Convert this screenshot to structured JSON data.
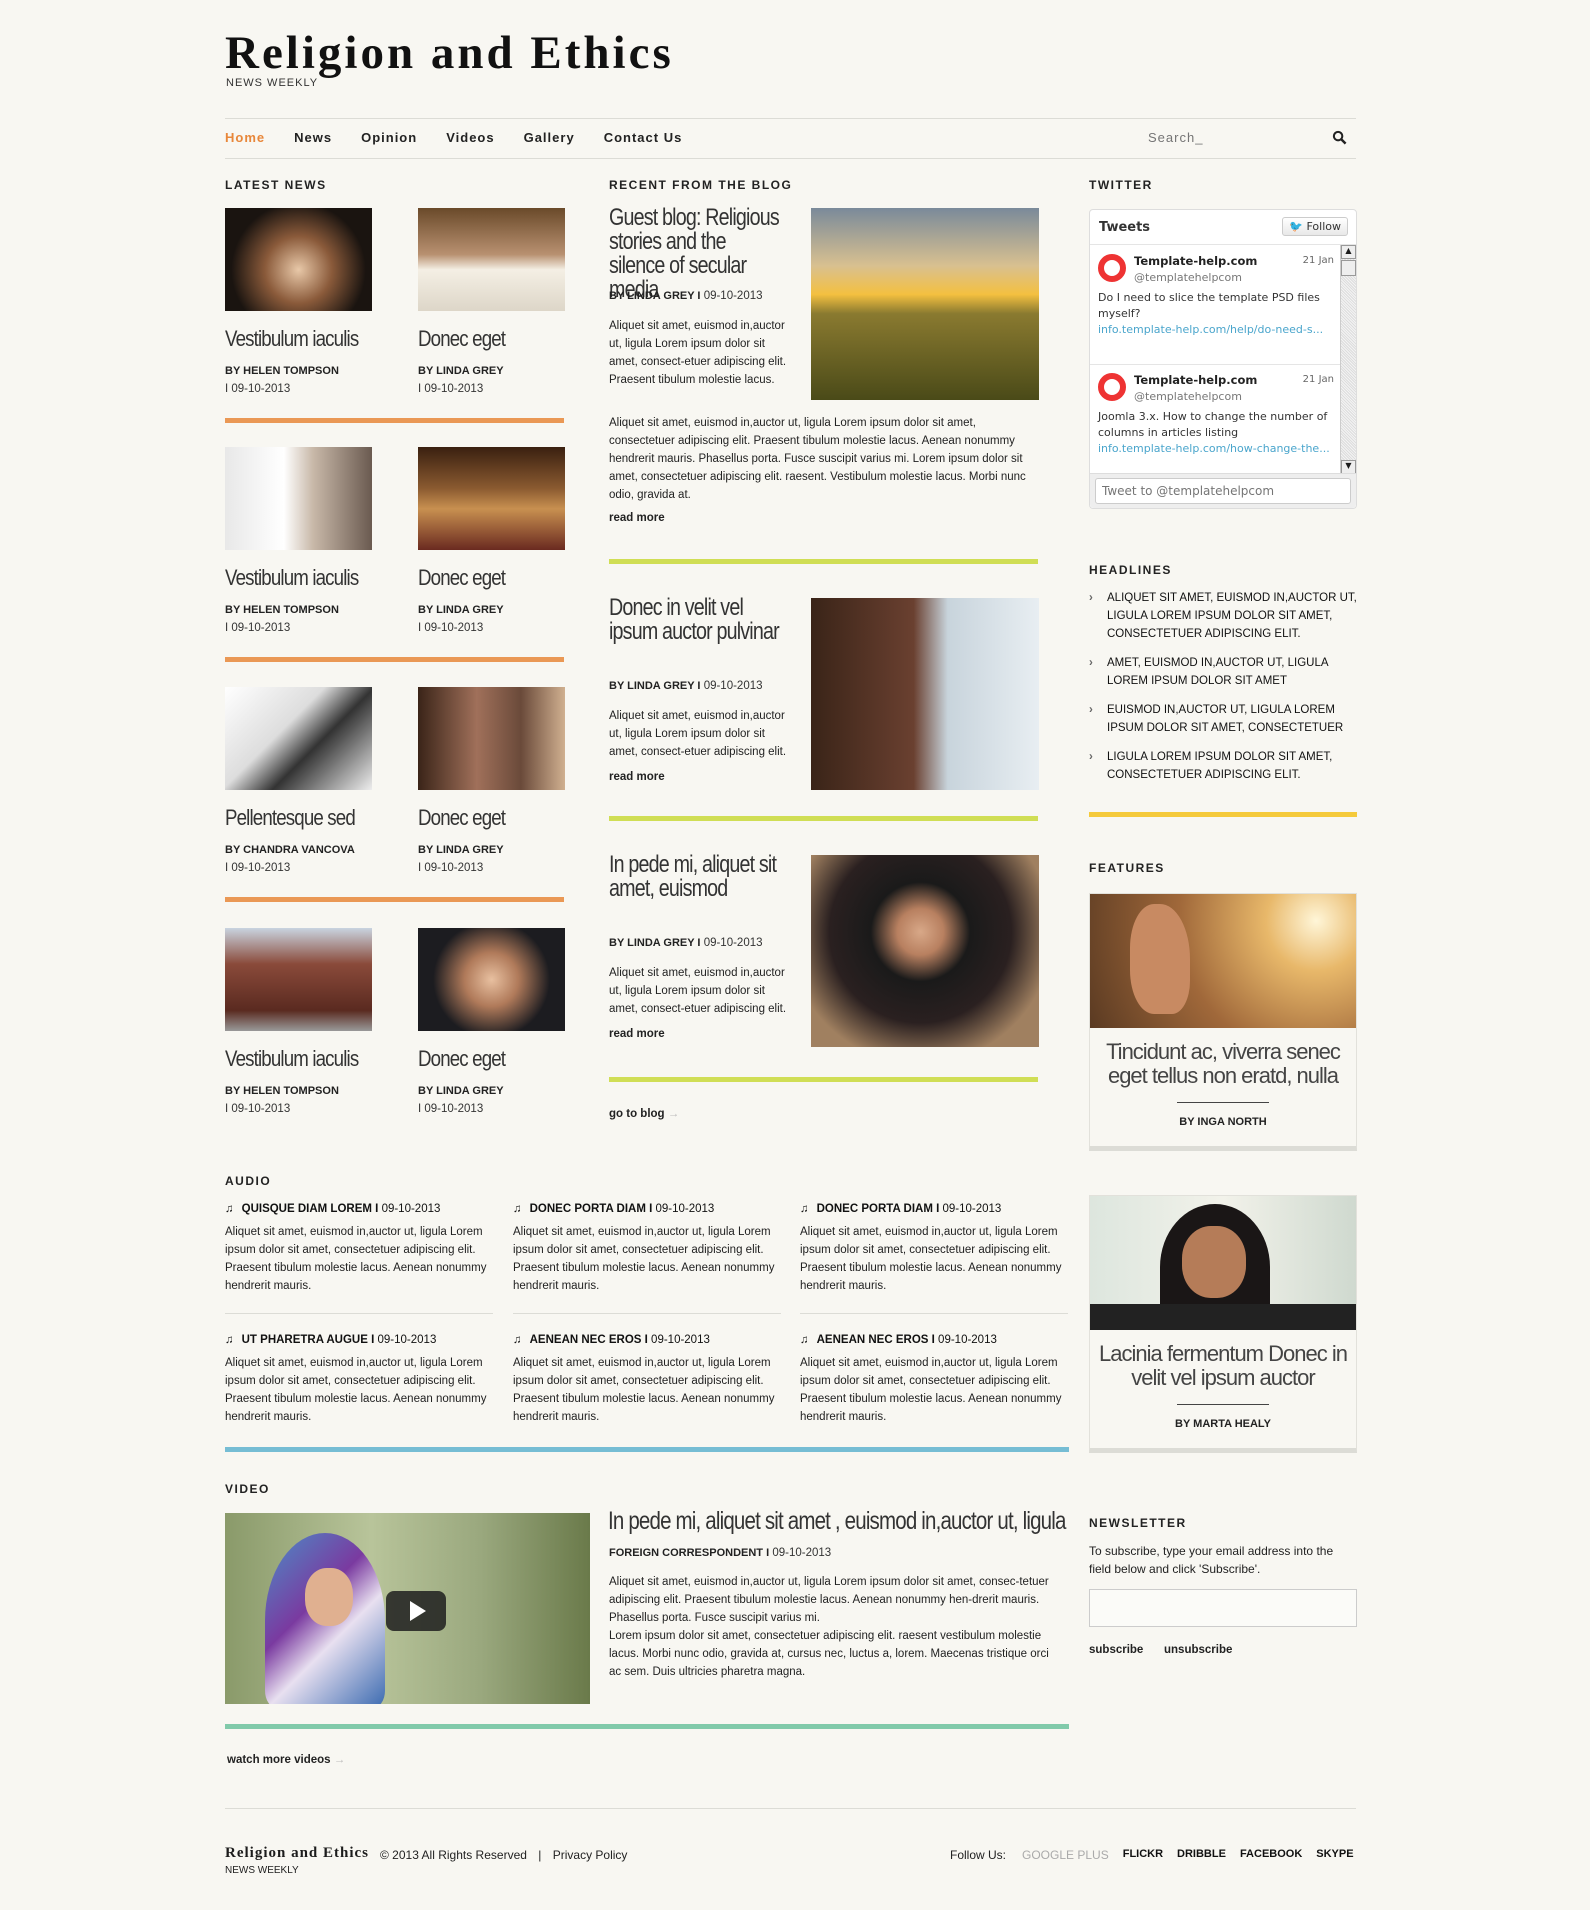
{
  "header": {
    "logo": "Religion and Ethics",
    "tagline": "NEWS WEEKLY"
  },
  "nav": {
    "items": [
      "Home",
      "News",
      "Opinion",
      "Videos",
      "Gallery",
      "Contact Us"
    ],
    "active": "Home",
    "search_placeholder": "Search_"
  },
  "colors": {
    "accent": "#e8873a",
    "news_bar": "#e8873a",
    "blog_bar": "#c9d93a",
    "headline_bar": "#f4c21b",
    "audio_bar": "#5fb3cf",
    "video_bar": "#6cc29e"
  },
  "latest": {
    "heading": "LATEST NEWS",
    "items": [
      {
        "title": "Vestibulum iaculis",
        "by": "BY HELEN TOMPSON",
        "date": "I 09-10-2013"
      },
      {
        "title": "Donec eget",
        "by": "BY LINDA GREY",
        "date": "I 09-10-2013"
      },
      {
        "title": "Vestibulum iaculis",
        "by": "BY HELEN TOMPSON",
        "date": "I 09-10-2013"
      },
      {
        "title": "Donec eget",
        "by": "BY LINDA GREY",
        "date": "I 09-10-2013"
      },
      {
        "title": "Pellentesque sed",
        "by": "BY CHANDRA VANCOVA",
        "date": "I 09-10-2013"
      },
      {
        "title": "Donec eget",
        "by": "BY LINDA GREY",
        "date": "I 09-10-2013"
      },
      {
        "title": "Vestibulum iaculis",
        "by": "BY HELEN TOMPSON",
        "date": "I 09-10-2013"
      },
      {
        "title": "Donec eget",
        "by": "BY LINDA GREY",
        "date": "I 09-10-2013"
      }
    ]
  },
  "blog": {
    "heading": "RECENT FROM THE BLOG",
    "posts": [
      {
        "title": "Guest blog: Religious stories  and the silence of secular media",
        "by": "BY LINDA GREY I",
        "date": "09-10-2013",
        "text": "Aliquet sit amet, euismod in,auctor ut, ligula Lorem ipsum dolor sit amet, consect-etuer adipiscing elit. Praesent tibulum molestie lacus.",
        "text2": "Aliquet sit amet, euismod in,auctor ut, ligula Lorem ipsum dolor sit amet, consectetuer adipiscing elit. Praesent tibulum molestie lacus. Aenean nonummy hendrerit mauris. Phasellus porta. Fusce suscipit varius mi. Lorem ipsum dolor sit amet, consectetuer adipiscing elit. raesent. Vestibulum molestie lacus. Morbi nunc odio, gravida at.",
        "more": "read more"
      },
      {
        "title": "Donec in velit vel ipsum auctor pulvinar",
        "by": "BY LINDA GREY I",
        "date": "09-10-2013",
        "text": "Aliquet sit amet, euismod in,auctor ut, ligula Lorem ipsum dolor sit amet, consect-etuer adipiscing elit.",
        "more": "read more"
      },
      {
        "title": "In pede mi, aliquet sit amet, euismod",
        "by": "BY LINDA GREY I",
        "date": "09-10-2013",
        "text": "Aliquet sit amet, euismod in,auctor ut, ligula Lorem ipsum dolor sit amet, consect-etuer adipiscing elit.",
        "more": "read more"
      }
    ],
    "go_to_blog": "go to  blog"
  },
  "twitter": {
    "heading": "TWITTER",
    "widget_title": "Tweets",
    "follow": "Follow",
    "tweets": [
      {
        "name": "Template-help.com",
        "handle": "@templatehelpcom",
        "date": "21 Jan",
        "text": "Do I need to slice the template PSD files myself?",
        "link": "info.template-help.com/help/do-need-s..."
      },
      {
        "name": "Template-help.com",
        "handle": "@templatehelpcom",
        "date": "21 Jan",
        "text": "Joomla 3.x. How to change the number of columns in articles listing",
        "link": "info.template-help.com/how-change-the..."
      }
    ],
    "tweet_placeholder": "Tweet to @templatehelpcom"
  },
  "headlines": {
    "heading": "HEADLINES",
    "items": [
      "ALIQUET SIT AMET, EUISMOD IN,AUCTOR UT, LIGULA LOREM IPSUM DOLOR SIT AMET, CONSECTETUER ADIPISCING ELIT.",
      "AMET, EUISMOD IN,AUCTOR UT, LIGULA LOREM IPSUM DOLOR SIT AMET",
      "EUISMOD IN,AUCTOR UT, LIGULA LOREM IPSUM DOLOR SIT AMET, CONSECTETUER",
      "LIGULA LOREM IPSUM DOLOR SIT AMET, CONSECTETUER ADIPISCING ELIT."
    ]
  },
  "features": {
    "heading": "FEATURES",
    "items": [
      {
        "title": "Tincidunt ac, viverra senec eget tellus non eratd, nulla",
        "by": "BY INGA NORTH"
      },
      {
        "title": "Lacinia fermentum Donec in velit vel ipsum auctor",
        "by": "BY MARTA HEALY"
      }
    ]
  },
  "audio": {
    "heading": "AUDIO",
    "items": [
      {
        "title": "QUISQUE DIAM LOREM I",
        "date": "09-10-2013",
        "text": "Aliquet sit amet, euismod in,auctor ut, ligula Lorem ipsum dolor sit amet, consectetuer adipiscing elit. Praesent tibulum molestie lacus. Aenean nonummy hendrerit mauris."
      },
      {
        "title": "DONEC PORTA DIAM I",
        "date": "09-10-2013",
        "text": "Aliquet sit amet, euismod in,auctor ut, ligula Lorem ipsum dolor sit amet, consectetuer adipiscing elit. Praesent tibulum molestie lacus. Aenean nonummy hendrerit mauris."
      },
      {
        "title": "DONEC PORTA DIAM I",
        "date": "09-10-2013",
        "text": "Aliquet sit amet, euismod in,auctor ut, ligula Lorem ipsum dolor sit amet, consectetuer adipiscing elit. Praesent tibulum molestie lacus. Aenean nonummy hendrerit mauris."
      },
      {
        "title": "UT PHARETRA AUGUE I",
        "date": "09-10-2013",
        "text": "Aliquet sit amet, euismod in,auctor ut, ligula Lorem ipsum dolor sit amet, consectetuer adipiscing elit. Praesent tibulum molestie lacus. Aenean nonummy hendrerit mauris."
      },
      {
        "title": "AENEAN NEC EROS I",
        "date": "09-10-2013",
        "text": "Aliquet sit amet, euismod in,auctor ut, ligula Lorem ipsum dolor sit amet, consectetuer adipiscing elit. Praesent tibulum molestie lacus. Aenean nonummy hendrerit mauris."
      },
      {
        "title": "AENEAN NEC EROS I",
        "date": "09-10-2013",
        "text": "Aliquet sit amet, euismod in,auctor ut, ligula Lorem ipsum dolor sit amet, consectetuer adipiscing elit. Praesent tibulum molestie lacus. Aenean nonummy hendrerit mauris."
      }
    ]
  },
  "video": {
    "heading": "VIDEO",
    "title": "In pede mi, aliquet sit amet , euismod in,auctor ut, ligula",
    "by": "FOREIGN CORRESPONDENT I",
    "date": "09-10-2013",
    "text": "Aliquet sit amet, euismod in,auctor ut, ligula Lorem ipsum dolor sit amet, consec-tetuer adipiscing elit. Praesent tibulum molestie lacus. Aenean nonummy hen-drerit mauris. Phasellus porta. Fusce suscipit varius mi.",
    "text2": "Lorem ipsum dolor sit amet, consectetuer adipiscing elit. raesent vestibulum molestie lacus. Morbi nunc odio, gravida at, cursus nec, luctus a, lorem. Maecenas tristique orci ac sem. Duis ultricies pharetra magna.",
    "watch_more": "watch more videos"
  },
  "newsletter": {
    "heading": "NEWSLETTER",
    "text": "To subscribe, type your email address into the field below and click 'Subscribe'.",
    "email_value": "",
    "subscribe": "subscribe",
    "unsubscribe": "unsubscribe"
  },
  "footer": {
    "logo": "Religion and Ethics",
    "tagline": "NEWS WEEKLY",
    "copyright": "© 2013 All Rights Reserved",
    "separator": "|",
    "privacy": "Privacy Policy",
    "follow_label": "Follow Us:",
    "social": [
      "GOOGLE PLUS",
      "FLICKR",
      "DRIBBLE",
      "FACEBOOK",
      "SKYPE"
    ]
  }
}
